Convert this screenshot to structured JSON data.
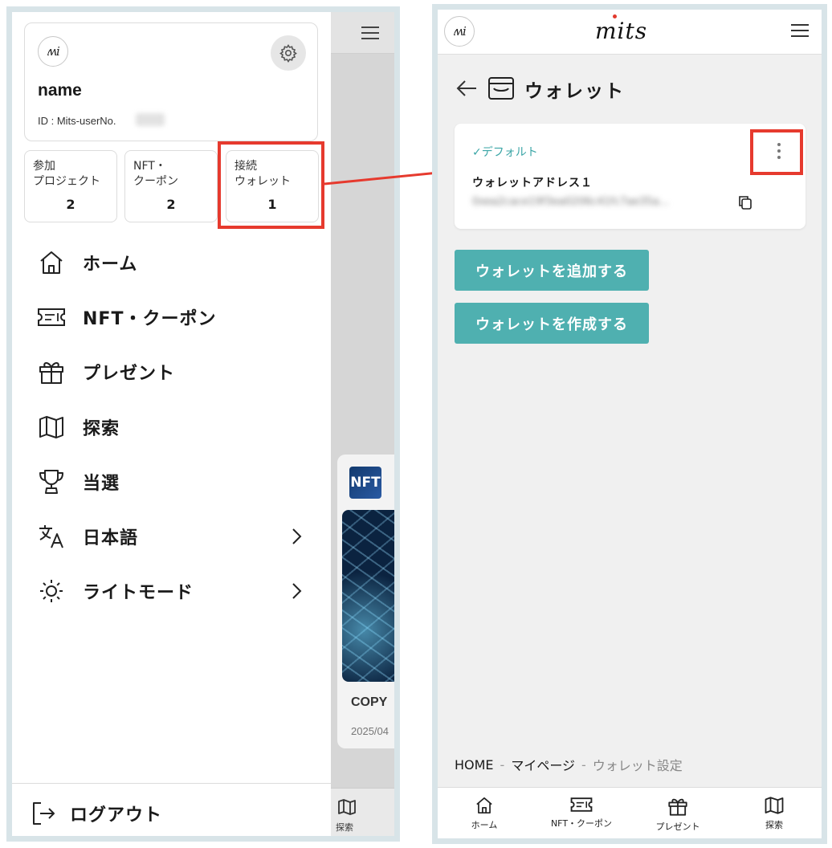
{
  "left": {
    "background_app": {
      "card_logo_text": "NFT",
      "card_title": "COPY",
      "card_date": "2025/04",
      "bottom_tab_label": "探索"
    },
    "profile": {
      "name": "name",
      "id_label": "ID : Mits-userNo."
    },
    "stats": [
      {
        "label": "参加\nプロジェクト",
        "value": "2"
      },
      {
        "label": "NFT・\nクーポン",
        "value": "2"
      },
      {
        "label": "接続\nウォレット",
        "value": "1"
      }
    ],
    "menu": [
      {
        "label": "ホーム",
        "icon": "home-icon"
      },
      {
        "label": "NFT・クーポン",
        "icon": "ticket-icon"
      },
      {
        "label": "プレゼント",
        "icon": "gift-icon"
      },
      {
        "label": "探索",
        "icon": "map-icon"
      },
      {
        "label": "当選",
        "icon": "trophy-icon"
      },
      {
        "label": "日本語",
        "icon": "translate-icon"
      },
      {
        "label": "ライトモード",
        "icon": "sun-icon"
      }
    ],
    "logout_label": "ログアウト"
  },
  "right": {
    "brand": "mits",
    "page_title": "ウォレット",
    "wallet": {
      "default_label": "✓デフォルト",
      "name": "ウォレットアドレス１",
      "address": "0xea2cace19f3ea0206c41fc7ae35a..."
    },
    "buttons": {
      "add_wallet": "ウォレットを追加する",
      "create_wallet": "ウォレットを作成する"
    },
    "breadcrumb": {
      "home": "HOME",
      "sep": "-",
      "mypage": "マイページ",
      "current": "ウォレット設定"
    },
    "bottom_nav": [
      {
        "label": "ホーム",
        "icon": "home-icon"
      },
      {
        "label": "NFT・クーポン",
        "icon": "ticket-icon"
      },
      {
        "label": "プレゼント",
        "icon": "gift-icon"
      },
      {
        "label": "探索",
        "icon": "map-icon"
      }
    ]
  },
  "colors": {
    "highlight": "#e63a2e",
    "accent_teal": "#4fb0b0",
    "default_text": "#3aa5a6"
  }
}
